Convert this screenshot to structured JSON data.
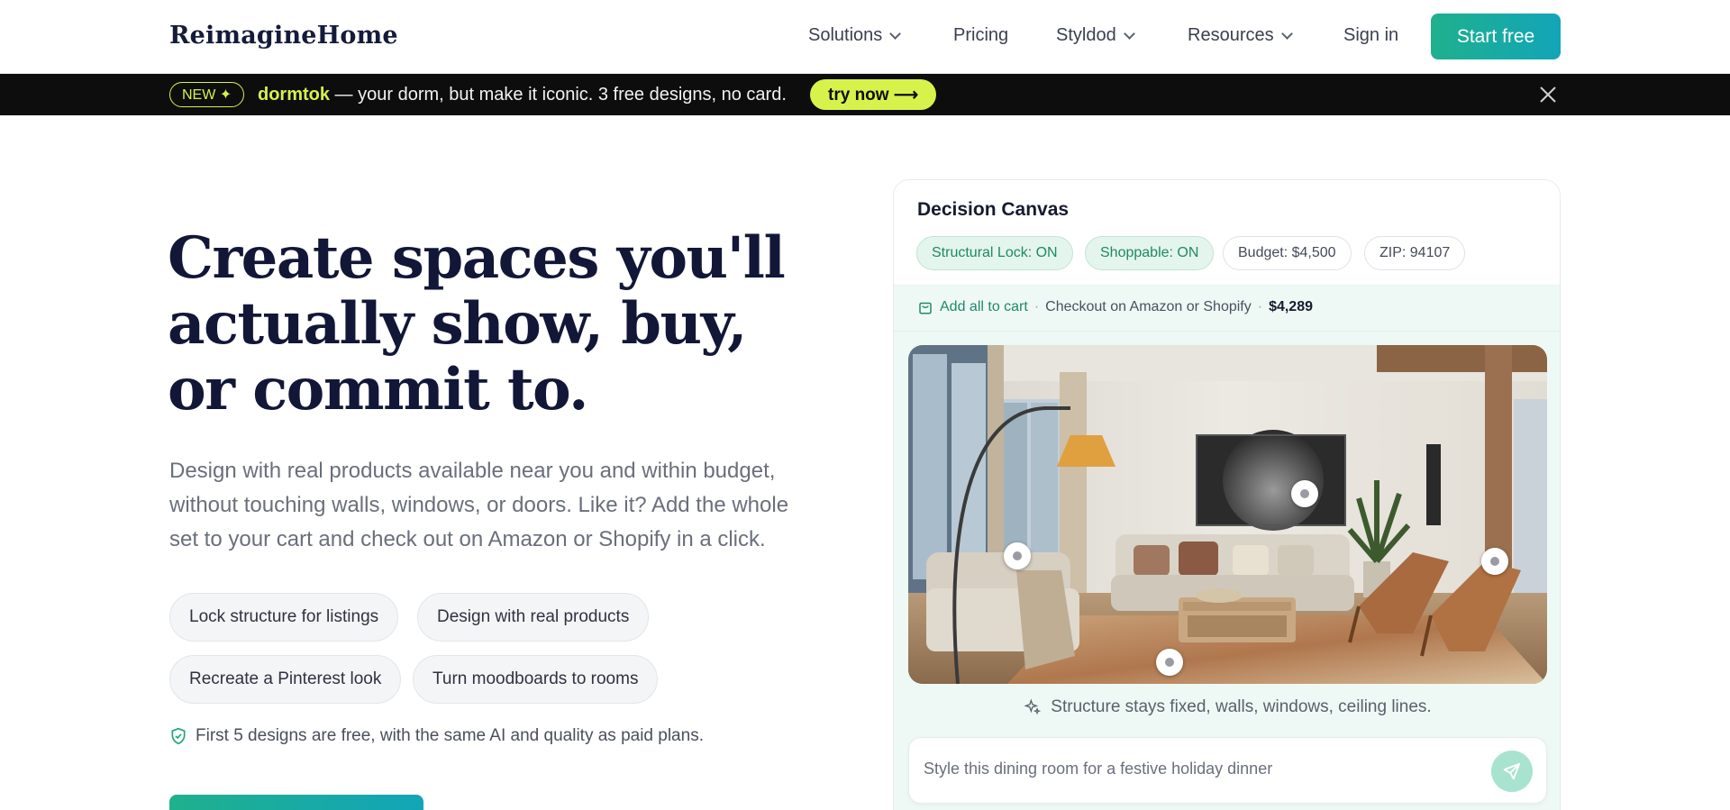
{
  "nav": {
    "logo": "ReimagineHome",
    "items": [
      {
        "label": "Solutions",
        "dropdown": true
      },
      {
        "label": "Pricing",
        "dropdown": false
      },
      {
        "label": "Styldod",
        "dropdown": true
      },
      {
        "label": "Resources",
        "dropdown": true
      }
    ],
    "sign_in": "Sign in",
    "start_free": "Start free"
  },
  "announcement": {
    "badge": "NEW ✦",
    "brand": "dormtok",
    "message": " — your dorm, but make it iconic. 3 free designs, no card.",
    "cta": "try now ⟶"
  },
  "hero": {
    "title": "Create spaces you'll actually show, buy, or commit to.",
    "subtitle": "Design with real products available near you and within budget, without touching walls, windows, or doors. Like it? Add the whole set to your cart and check out on Amazon or Shopify in a click.",
    "chips": [
      "Lock structure for listings",
      "Design with real products",
      "Recreate a Pinterest look",
      "Turn moodboards to rooms"
    ],
    "free_note": "First 5 designs are free, with the same AI and quality as paid plans."
  },
  "canvas": {
    "title": "Decision Canvas",
    "pills": [
      "Structural Lock: ON",
      "Shoppable: ON",
      "Budget: $4,500",
      "ZIP: 94107"
    ],
    "cart": {
      "action": "Add all to cart",
      "checkout": "Checkout on Amazon or Shopify",
      "total": "$4,289"
    },
    "structure_note": "Structure stays fixed, walls, windows, ceiling lines.",
    "prompt_placeholder": "Style this dining room for a festive holiday dinner"
  },
  "colors": {
    "accent_start": "#1fb08d",
    "accent_end": "#12a5b8",
    "announce_bg": "#0d0d0d",
    "announce_accent": "#d7f24a",
    "title_color": "#121738"
  }
}
